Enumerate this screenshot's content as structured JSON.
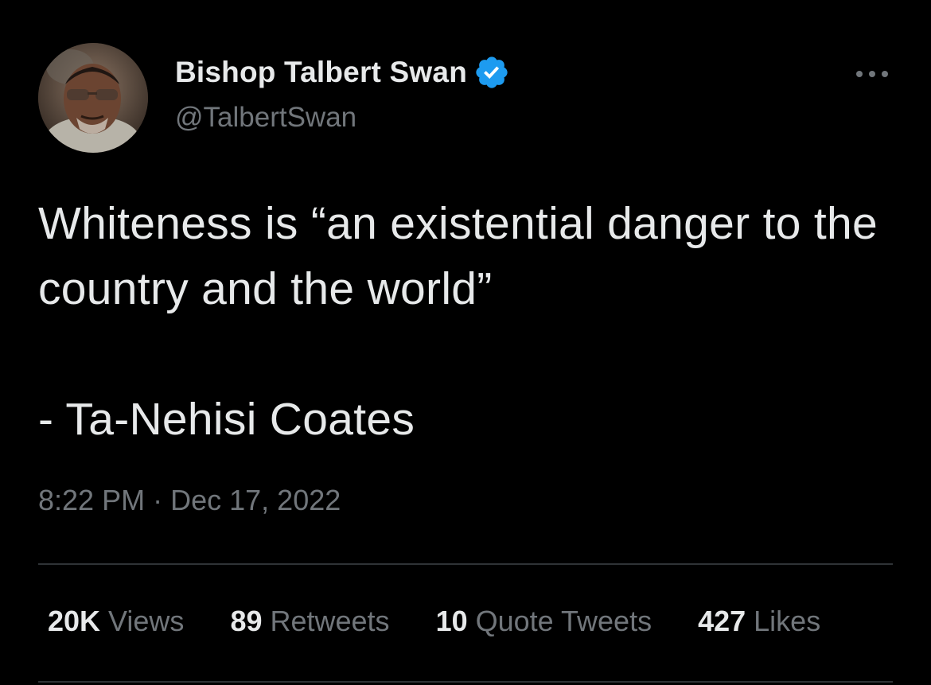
{
  "author": {
    "display_name": "Bishop Talbert Swan",
    "handle": "@TalbertSwan",
    "verified_icon": "verified-badge-icon",
    "verified_color": "#1d9bf0"
  },
  "tweet": {
    "text": "Whiteness is “an existential danger to the country and the world”\n\n- Ta-Nehisi Coates",
    "time": "8:22 PM",
    "separator": "·",
    "date": "Dec 17, 2022"
  },
  "stats": {
    "views": {
      "count": "20K",
      "label": "Views"
    },
    "retweets": {
      "count": "89",
      "label": "Retweets"
    },
    "quote_tweets": {
      "count": "10",
      "label": "Quote Tweets"
    },
    "likes": {
      "count": "427",
      "label": "Likes"
    }
  },
  "icons": {
    "more": "more-horizontal-icon",
    "avatar": "avatar"
  },
  "colors": {
    "background": "#000000",
    "text_primary": "#e7e9ea",
    "text_secondary": "#71767b",
    "divider": "#2f3336"
  }
}
